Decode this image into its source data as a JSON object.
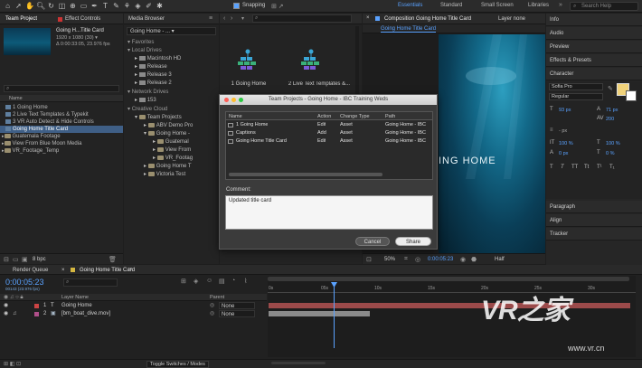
{
  "toolbar": {
    "snapping_label": "Snapping",
    "workspaces": [
      "Essentials",
      "Standard",
      "Small Screen",
      "Libraries"
    ],
    "search_placeholder": "Search Help"
  },
  "project_panel": {
    "tabs": [
      "Team Project",
      "Effect Controls"
    ],
    "item_title": "Going H...Title Card",
    "item_size": "1920 x 1080  (30) ▾",
    "item_duration": "Δ 0:00:33:05, 23.976 fps",
    "column_name": "Name",
    "items": [
      {
        "label": "1 Going Home",
        "kind": "comp"
      },
      {
        "label": "2 Live Text Templates & Typekit",
        "kind": "comp"
      },
      {
        "label": "3 VR Auto Detect & Hide Controls",
        "kind": "comp"
      },
      {
        "label": "Going Home Title Card",
        "kind": "comp",
        "selected": true
      },
      {
        "label": "Guatemala Footage",
        "kind": "folder"
      },
      {
        "label": "View From Blue Moon Media",
        "kind": "folder"
      },
      {
        "label": "VR_Footage_Temp",
        "kind": "folder"
      }
    ],
    "bpc": "8 bpc"
  },
  "media_browser": {
    "tab": "Media Browser",
    "path": "Going Home - ...",
    "sections": [
      {
        "label": "Favorites",
        "children": []
      },
      {
        "label": "Local Drives",
        "children": [
          "Macintosh HD",
          "Release",
          "Release 3",
          "Release 2"
        ]
      },
      {
        "label": "Network Drives",
        "children": [
          "153"
        ]
      },
      {
        "label": "Creative Cloud",
        "children": [
          "Team Projects"
        ]
      }
    ],
    "team_projects": [
      "ABV Demo Pro",
      "Going Home -",
      "Guatemal",
      "View From",
      "VR_Footag",
      "Going Home T",
      "Victoria Test"
    ],
    "grid_items": [
      "1 Going Home",
      "2 Live Text Templates &..."
    ]
  },
  "composition": {
    "tab": "Composition Going Home Title Card",
    "tab2": "Layer none",
    "subtab": "Going Home Title Card",
    "overlay_text": "ING HOME",
    "zoom": "50%",
    "timecode": "0:00:05:23",
    "view": "Half"
  },
  "dialog": {
    "title": "Team Projects - Going Home - IBC Training Weds",
    "columns": [
      "Name",
      "Action",
      "Change Type",
      "Path"
    ],
    "rows": [
      {
        "name": "1 Going Home",
        "action": "Edit",
        "change": "Asset",
        "path": "Going Home - IBC"
      },
      {
        "name": "Captions",
        "action": "Add",
        "change": "Asset",
        "path": "Going Home - IBC"
      },
      {
        "name": "Going Home Title Card",
        "action": "Edit",
        "change": "Asset",
        "path": "Going Home - IBC"
      }
    ],
    "comment_label": "Comment:",
    "comment_value": "Updated title card",
    "cancel_label": "Cancel",
    "share_label": "Share"
  },
  "right_panel": {
    "sections": [
      "Info",
      "Audio",
      "Preview",
      "Effects & Presets",
      "Character"
    ],
    "font": "Sofia Pro",
    "style": "Regular",
    "font_size": "93 px",
    "leading": "71 px",
    "tracking": "200",
    "stroke_unit": "- px",
    "vscale": "100 %",
    "hscale": "100 %",
    "baseline": "0 px",
    "tsume": "0 %",
    "type_buttons": [
      "T",
      "T",
      "TT",
      "Tt",
      "T¹",
      "T₁"
    ],
    "lower_sections": [
      "Paragraph",
      "Align",
      "Tracker"
    ]
  },
  "timeline": {
    "tabs": [
      "Render Queue",
      "Going Home Title Card"
    ],
    "timecode": "0:00:05:23",
    "frame_info": "00143 (23.976 fps)",
    "column_layer_name": "Layer Name",
    "column_parent": "Parent",
    "layers": [
      {
        "num": "1",
        "type": "T",
        "name": "Going Home",
        "parent": "None"
      },
      {
        "num": "2",
        "type": "▣",
        "name": "[bm_boat_dive.mov]",
        "parent": "None"
      }
    ],
    "ruler": [
      "0s",
      "05s",
      "10s",
      "15s",
      "20s",
      "25s",
      "30s"
    ],
    "toggle_label": "Toggle Switches / Modes"
  },
  "watermark": {
    "logo_text": "VR之家",
    "url": "www.vr.cn"
  },
  "colors": {
    "accent_blue": "#5aa2ff",
    "layer1_bar": "#9b4a4a",
    "layer2_bar": "#8a8a8a",
    "swatch": "#f0d27a"
  }
}
